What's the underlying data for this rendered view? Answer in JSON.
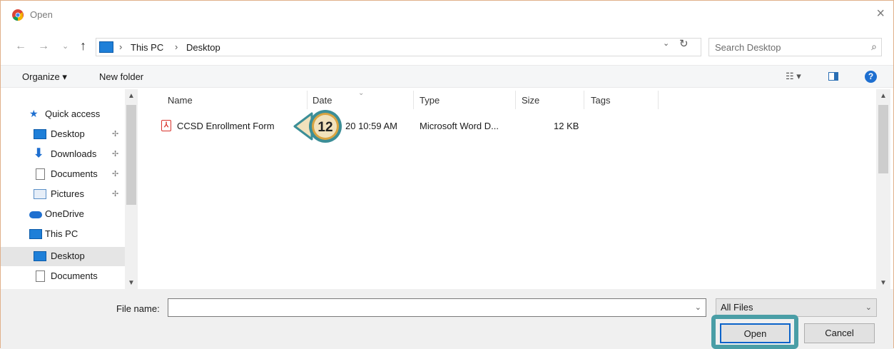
{
  "window": {
    "title": "Open",
    "close_glyph": "×"
  },
  "nav": {
    "back": "←",
    "forward": "→",
    "recent": "⌄",
    "up": "↑",
    "breadcrumbs": [
      "This PC",
      "Desktop"
    ],
    "separator": "›",
    "refresh": "↻",
    "dropdown": "⌄",
    "search_placeholder": "Search Desktop",
    "search_glyph": "⌕"
  },
  "toolbar": {
    "organize": "Organize ▾",
    "new_folder": "New folder",
    "view_glyph": "☷ ▾",
    "help": "?"
  },
  "sidebar": {
    "items": [
      {
        "label": "Quick access",
        "icon": "star-icon",
        "pinned": false
      },
      {
        "label": "Desktop",
        "icon": "desktop-folder-icon",
        "pinned": true
      },
      {
        "label": "Downloads",
        "icon": "download-arrow-icon",
        "pinned": true
      },
      {
        "label": "Documents",
        "icon": "documents-icon",
        "pinned": true
      },
      {
        "label": "Pictures",
        "icon": "pictures-icon",
        "pinned": true
      },
      {
        "label": "OneDrive",
        "icon": "cloud-icon",
        "pinned": false
      },
      {
        "label": "This PC",
        "icon": "computer-icon",
        "pinned": false
      },
      {
        "label": "Desktop",
        "icon": "desktop-folder-icon",
        "pinned": false,
        "selected": true
      },
      {
        "label": "Documents",
        "icon": "documents-icon",
        "pinned": false
      }
    ],
    "pin_glyph": "✢"
  },
  "filelist": {
    "columns": [
      "Name",
      "Date",
      "Type",
      "Size",
      "Tags"
    ],
    "rows": [
      {
        "name": "CCSD Enrollment Form",
        "date": "20 10:59 AM",
        "type": "Microsoft Word D...",
        "size": "12 KB"
      }
    ]
  },
  "callout": {
    "number": "12"
  },
  "footer": {
    "file_name_label": "File name:",
    "file_name_value": "",
    "filter": "All Files",
    "open": "Open",
    "cancel": "Cancel"
  },
  "colors": {
    "accent": "#0a63c9",
    "highlight": "#4a9ea6",
    "callout_fill": "#f2e2bc",
    "callout_ring": "#d9a441"
  }
}
